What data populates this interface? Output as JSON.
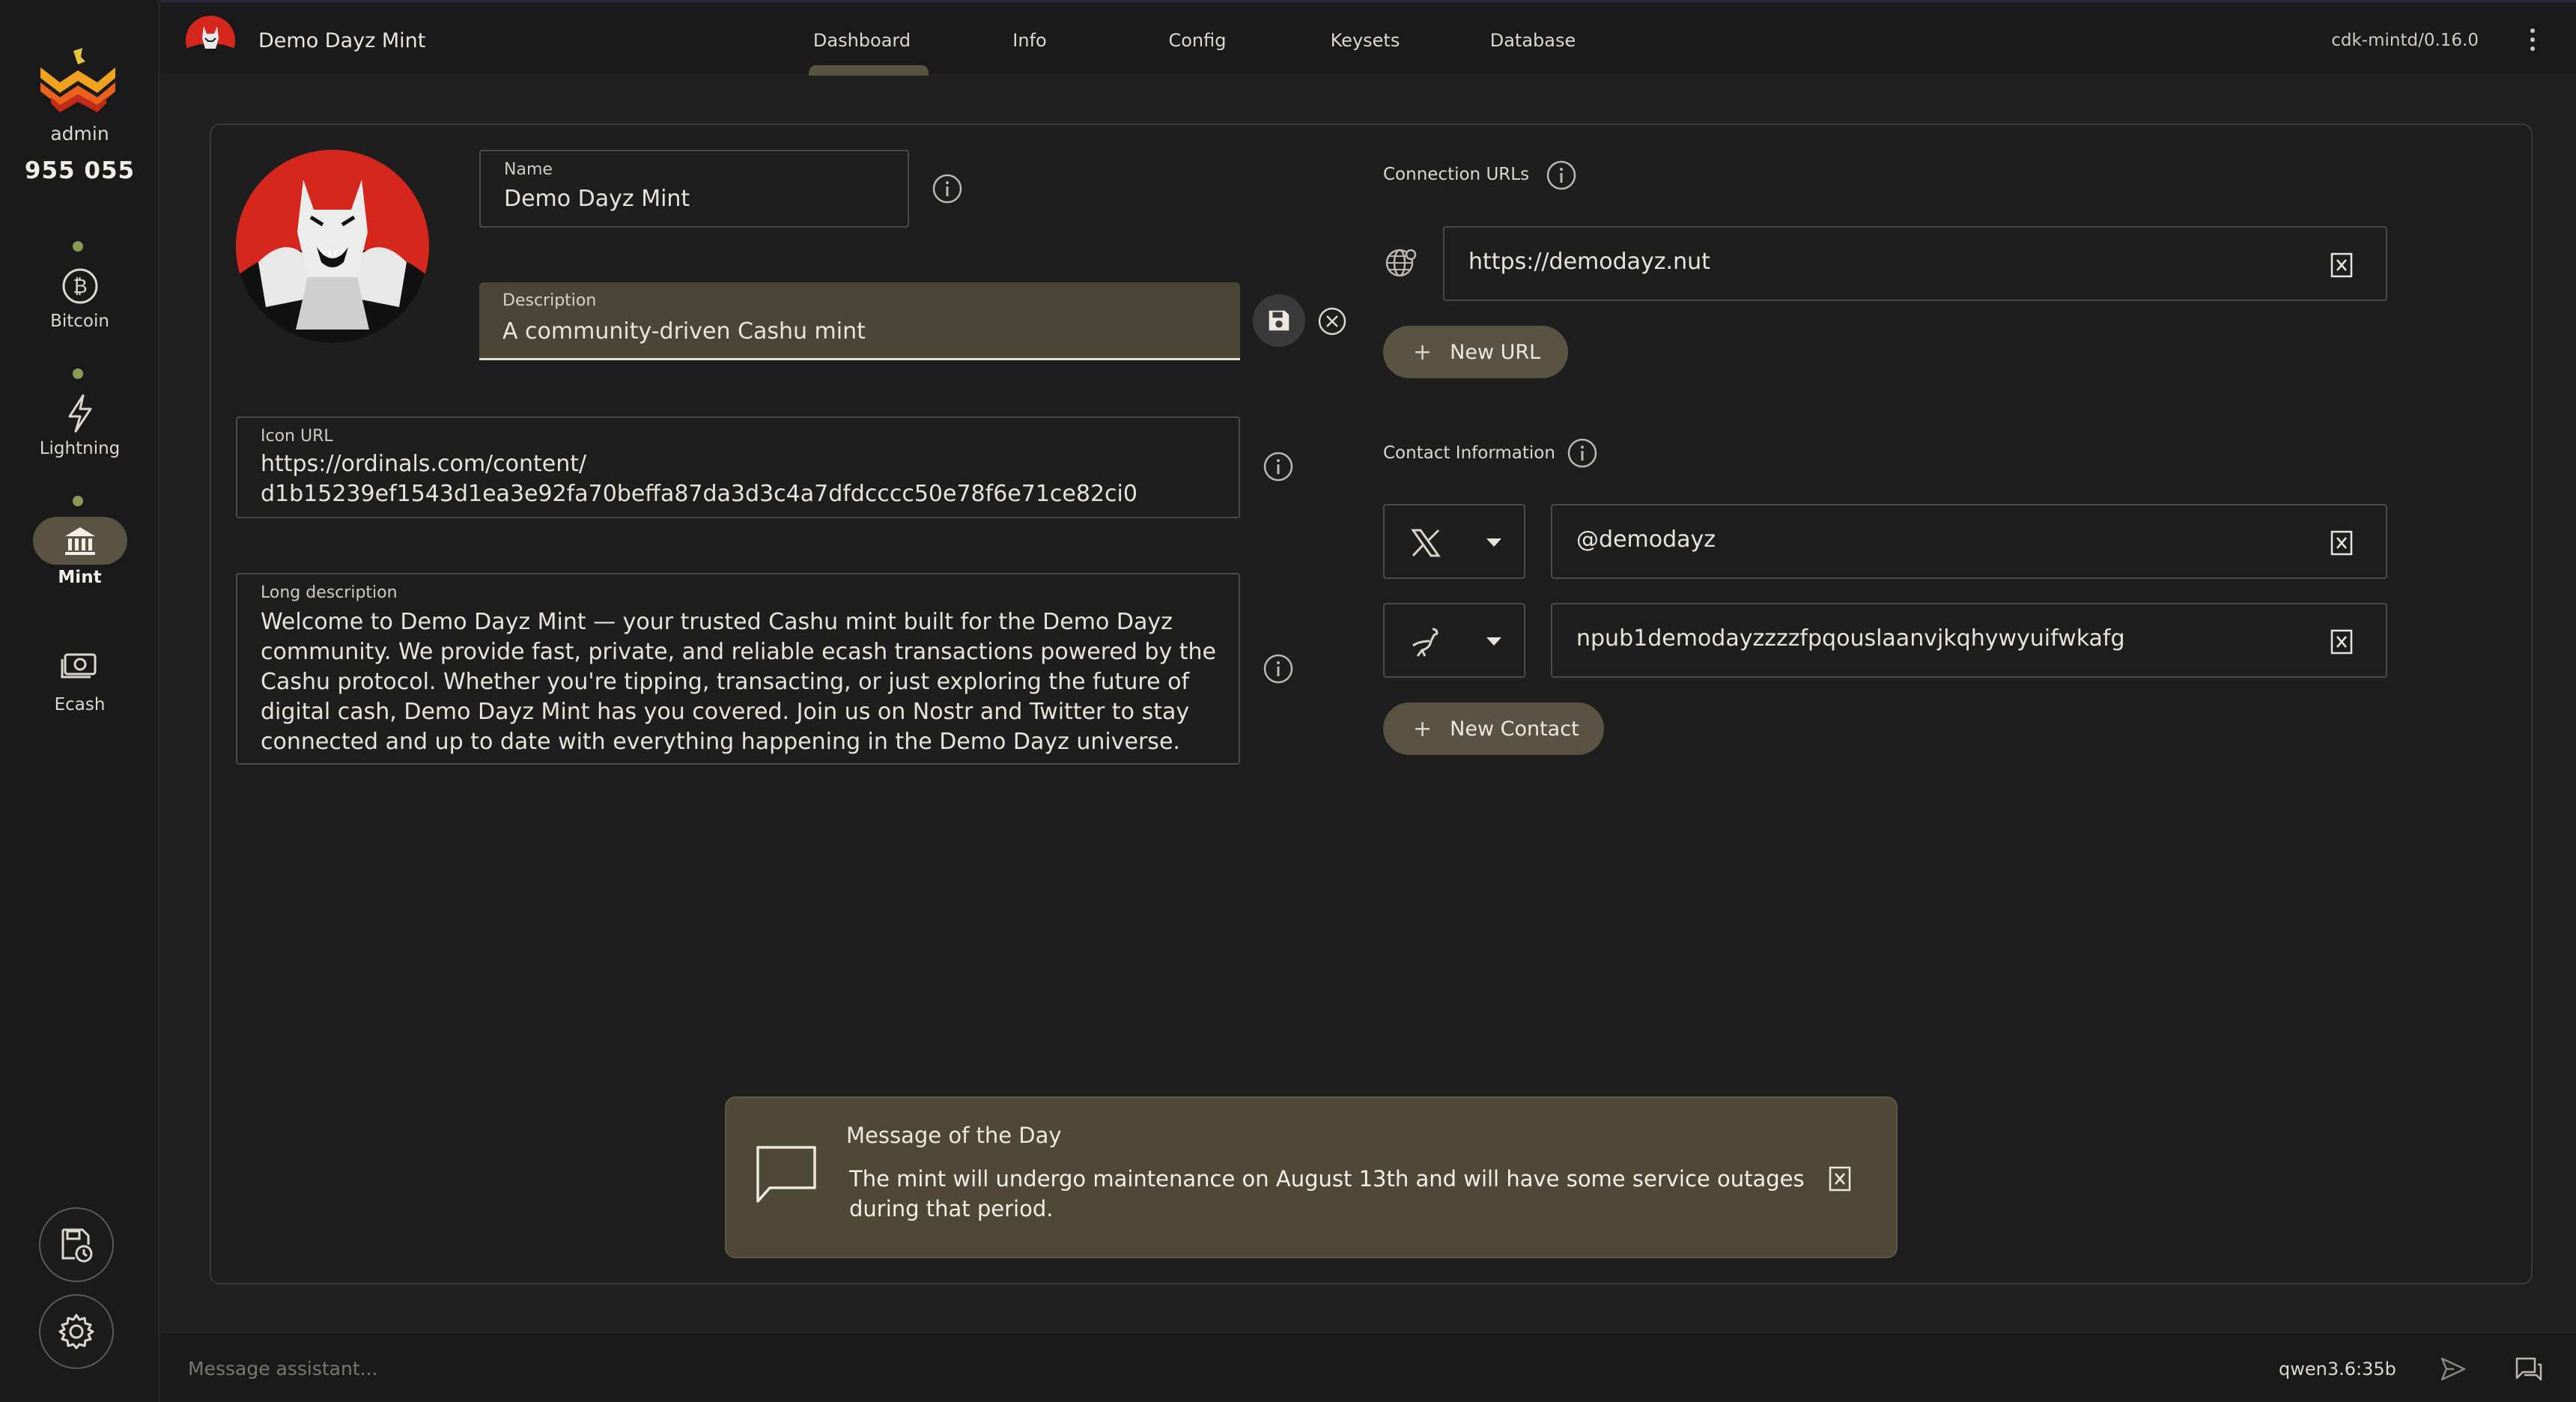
{
  "sidebar": {
    "user": "admin",
    "balance": "955 055",
    "items": [
      {
        "label": "Bitcoin",
        "icon": "bitcoin-icon"
      },
      {
        "label": "Lightning",
        "icon": "lightning-icon"
      },
      {
        "label": "Mint",
        "icon": "bank-icon"
      },
      {
        "label": "Ecash",
        "icon": "cash-icon"
      }
    ]
  },
  "header": {
    "title": "Demo Dayz Mint",
    "tabs": [
      "Dashboard",
      "Info",
      "Config",
      "Keysets",
      "Database"
    ],
    "active_tab": "Info",
    "version": "cdk-mintd/0.16.0"
  },
  "form": {
    "name_label": "Name",
    "name_value": "Demo Dayz Mint",
    "description_label": "Description",
    "description_value": "A community-driven Cashu mint",
    "icon_url_label": "Icon URL",
    "icon_url_line1": "https://ordinals.com/content/",
    "icon_url_line2": "d1b15239ef1543d1ea3e92fa70beffa87da3d3c4a7dfdcccc50e78f6e71ce82ci0",
    "long_description_label": "Long description",
    "long_description_lines": [
      "Welcome to Demo Dayz Mint — your trusted Cashu mint built for the Demo Dayz",
      "community. We provide fast, private, and reliable ecash transactions powered by the",
      "Cashu protocol. Whether you're tipping, transacting, or just exploring the future of",
      "digital cash, Demo Dayz Mint has you covered. Join us on Nostr and Twitter to stay",
      "connected and up to date with everything happening in the Demo Dayz universe."
    ]
  },
  "connection": {
    "label": "Connection URLs",
    "urls": [
      "https://demodayz.nut"
    ],
    "new_url_label": "New URL"
  },
  "contact": {
    "label": "Contact Information",
    "entries": [
      {
        "type": "x",
        "value": "@demodayz"
      },
      {
        "type": "nostr",
        "value": "npub1demodayzzzzfpqouslaanvjkqhywyuifwkafg"
      }
    ],
    "new_contact_label": "New Contact"
  },
  "motd": {
    "title": "Message of the Day",
    "line1": "The mint will undergo maintenance on August 13th and will have some service outages",
    "line2": "during that period."
  },
  "assistant": {
    "placeholder": "Message assistant...",
    "model": "qwen3.6:35b"
  },
  "colors": {
    "accent_pill": "#5a5344",
    "status_dot": "#8a9a54",
    "brand_red": "#d6271e",
    "motd_bg": "#4f4836"
  }
}
